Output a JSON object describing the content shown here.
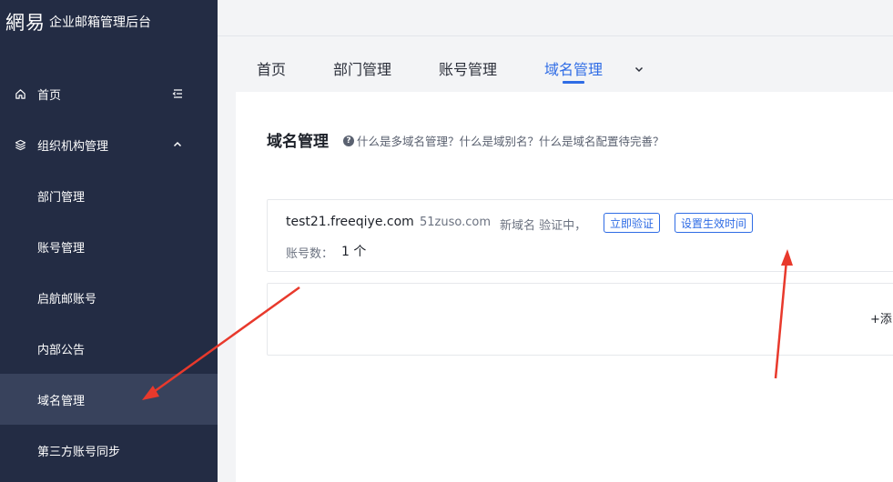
{
  "brand": {
    "logo": "網易",
    "title": "企业邮箱管理后台"
  },
  "sidebar": {
    "items": [
      {
        "label": "首页",
        "icon": "home-icon",
        "right_icon": "collapse-menu-icon"
      },
      {
        "label": "组织机构管理",
        "icon": "organization-icon",
        "right_icon": "chevron-up-icon"
      },
      {
        "label": "部门管理"
      },
      {
        "label": "账号管理"
      },
      {
        "label": "启航邮账号"
      },
      {
        "label": "内部公告"
      },
      {
        "label": "域名管理",
        "active": true
      },
      {
        "label": "第三方账号同步"
      }
    ]
  },
  "tabs": [
    {
      "label": "首页"
    },
    {
      "label": "部门管理"
    },
    {
      "label": "账号管理"
    },
    {
      "label": "域名管理",
      "active": true
    }
  ],
  "main": {
    "title": "域名管理",
    "help_text": "什么是多域名管理？什么是域别名？什么是域名配置待完善？",
    "domain": {
      "name": "test21.freeqiye.com",
      "alias": "51zuso.com",
      "status": "新域名 验证中，",
      "verify_button": "立即验证",
      "set_time_button": "设置生效时间",
      "account_count_label": "账号数：",
      "account_count_value": "1 个"
    },
    "add_link": "+添"
  },
  "colors": {
    "sidebar_bg": "#232c44",
    "sidebar_active": "#38425c",
    "accent": "#2f6ce5",
    "annotation": "#e8392c"
  }
}
